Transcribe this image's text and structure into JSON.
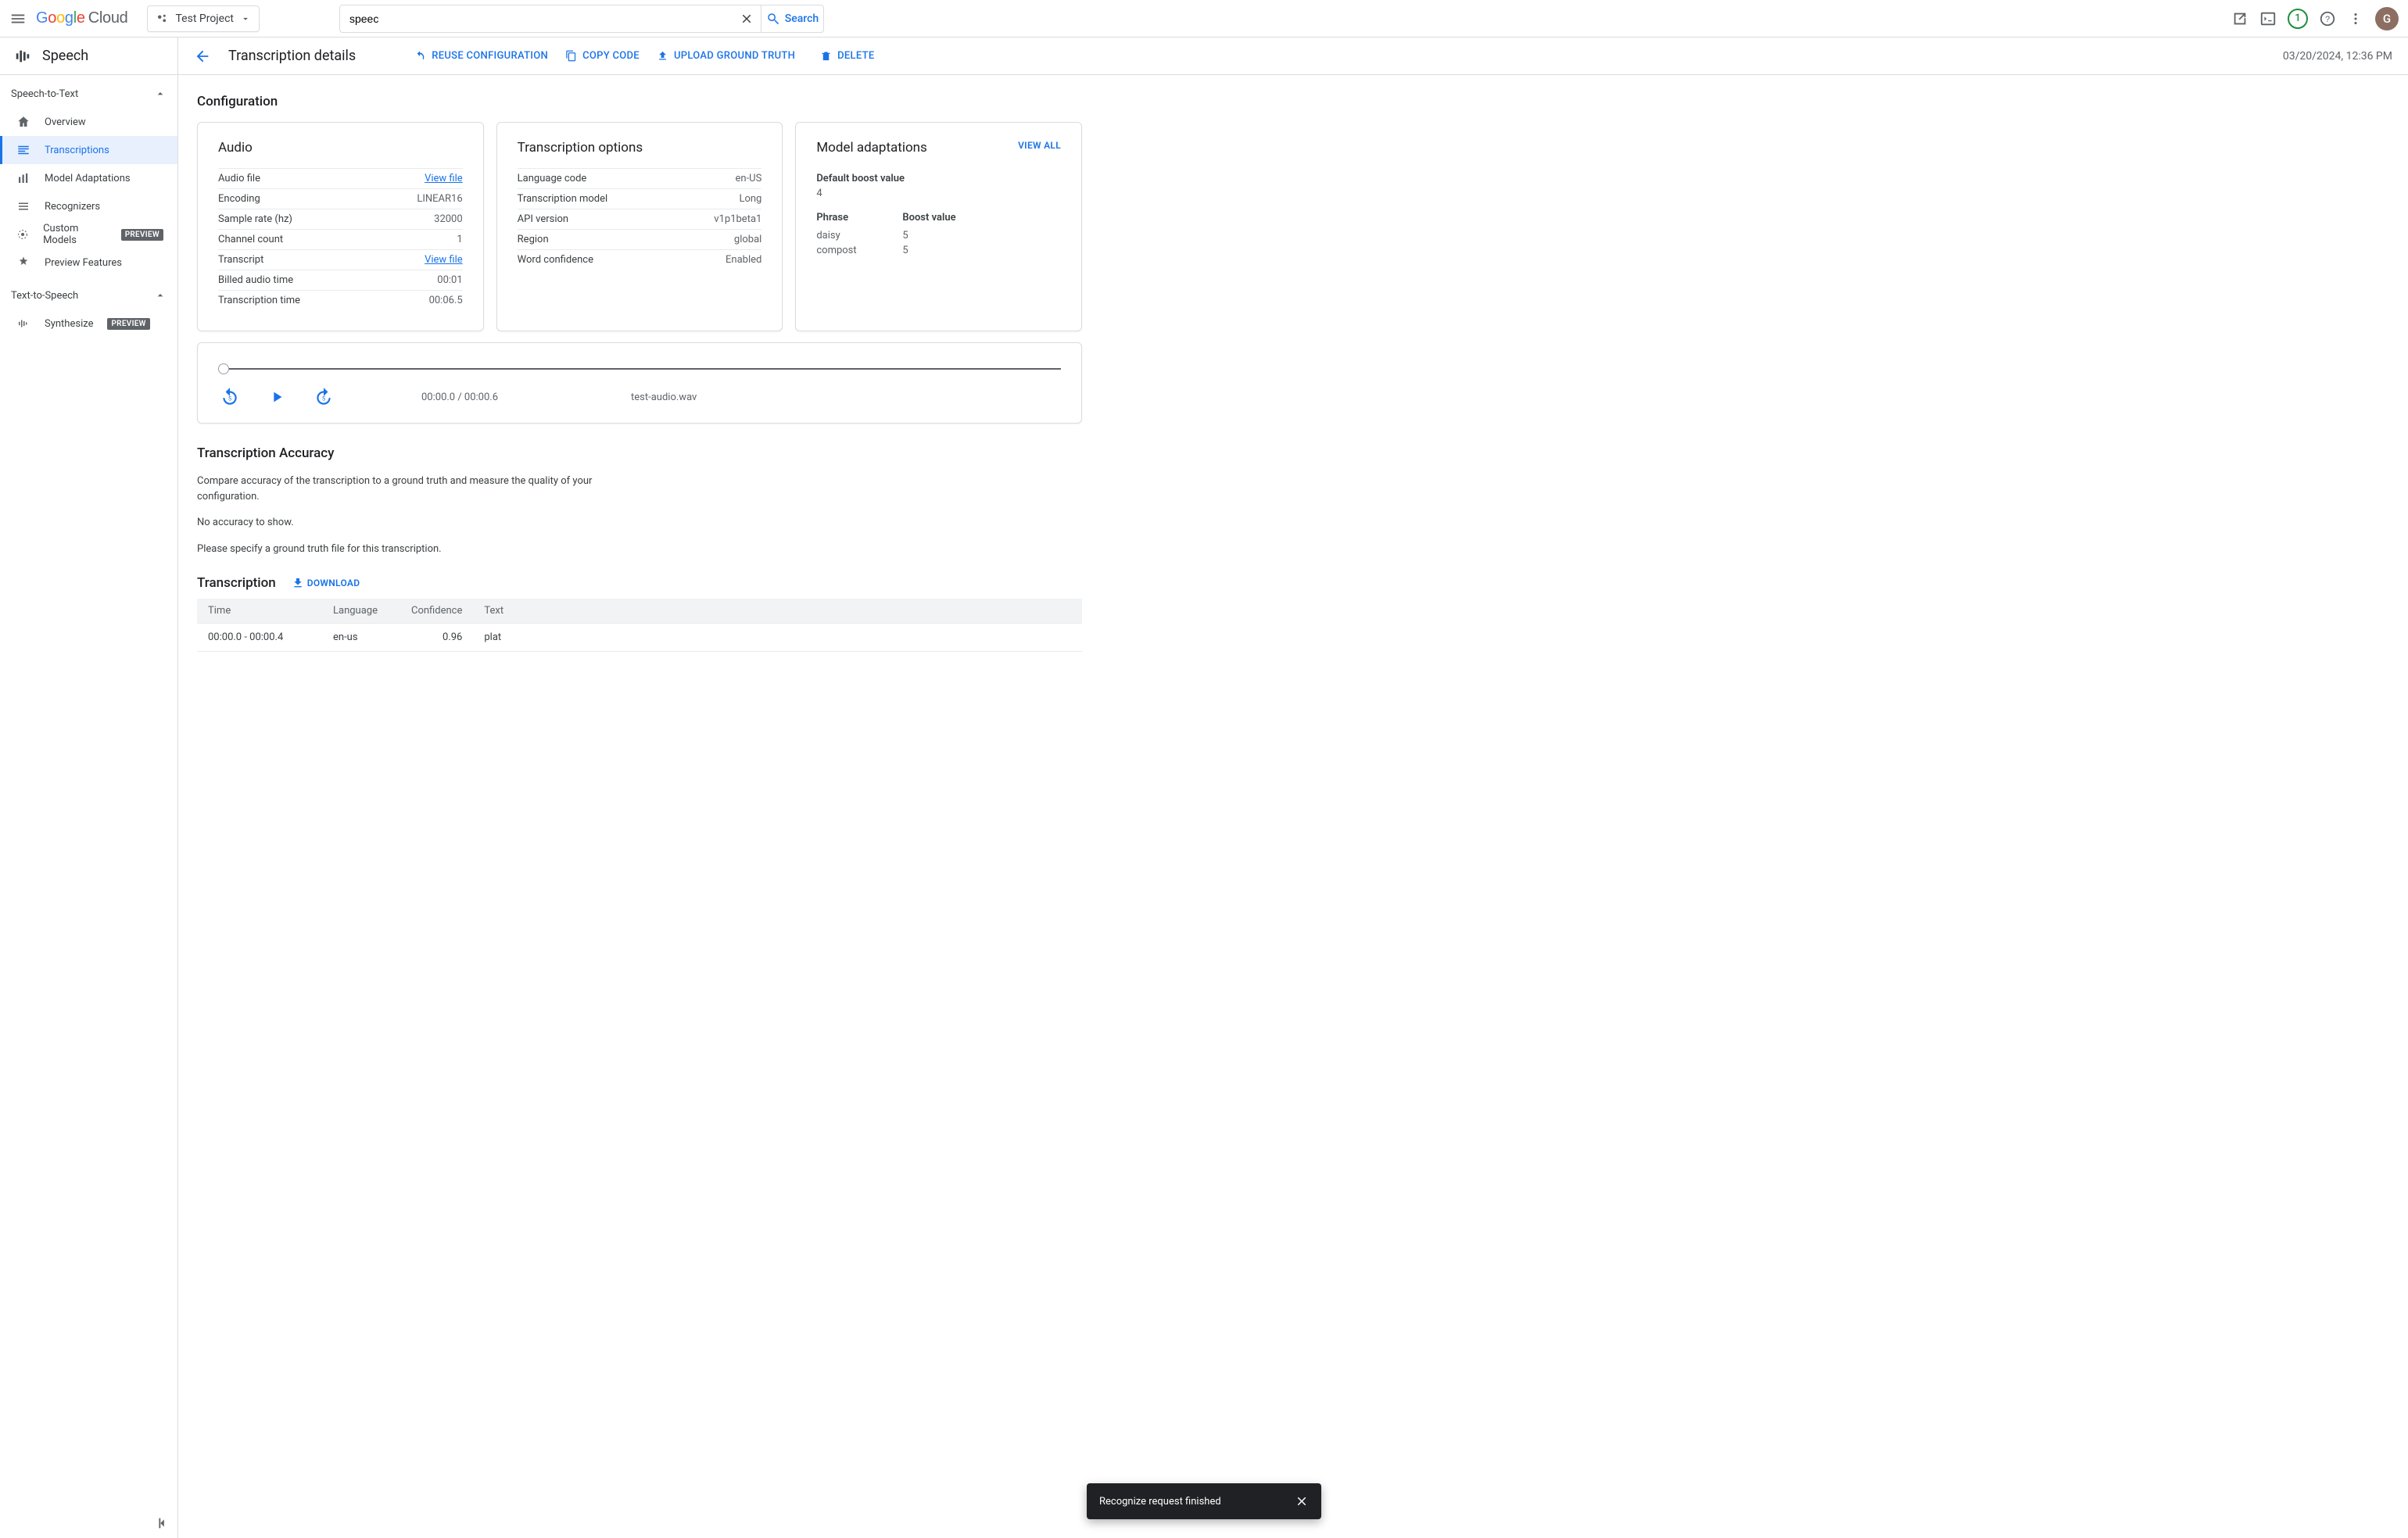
{
  "header": {
    "logo_cloud": "Cloud",
    "project": "Test Project",
    "search_value": "speec",
    "search_button": "Search",
    "free_trial_badge": "1",
    "avatar_letter": "G"
  },
  "sidebar": {
    "product": "Speech",
    "sections": [
      {
        "label": "Speech-to-Text",
        "items": [
          {
            "label": "Overview",
            "active": false,
            "preview": false
          },
          {
            "label": "Transcriptions",
            "active": true,
            "preview": false
          },
          {
            "label": "Model Adaptations",
            "active": false,
            "preview": false
          },
          {
            "label": "Recognizers",
            "active": false,
            "preview": false
          },
          {
            "label": "Custom Models",
            "active": false,
            "preview": true
          },
          {
            "label": "Preview Features",
            "active": false,
            "preview": false
          }
        ]
      },
      {
        "label": "Text-to-Speech",
        "items": [
          {
            "label": "Synthesize",
            "active": false,
            "preview": true
          }
        ]
      }
    ],
    "preview_badge": "PREVIEW"
  },
  "page": {
    "title": "Transcription details",
    "actions": {
      "reuse": "REUSE CONFIGURATION",
      "copy": "COPY CODE",
      "upload": "UPLOAD GROUND TRUTH",
      "delete": "DELETE"
    },
    "timestamp": "03/20/2024, 12:36 PM"
  },
  "config": {
    "heading": "Configuration",
    "audio": {
      "title": "Audio",
      "rows": [
        {
          "k": "Audio file",
          "v": "View file",
          "link": true
        },
        {
          "k": "Encoding",
          "v": "LINEAR16"
        },
        {
          "k": "Sample rate (hz)",
          "v": "32000"
        },
        {
          "k": "Channel count",
          "v": "1"
        },
        {
          "k": "Transcript",
          "v": "View file",
          "link": true
        },
        {
          "k": "Billed audio time",
          "v": "00:01"
        },
        {
          "k": "Transcription time",
          "v": "00:06.5"
        }
      ]
    },
    "options": {
      "title": "Transcription options",
      "rows": [
        {
          "k": "Language code",
          "v": "en-US"
        },
        {
          "k": "Transcription model",
          "v": "Long"
        },
        {
          "k": "API version",
          "v": "v1p1beta1"
        },
        {
          "k": "Region",
          "v": "global"
        },
        {
          "k": "Word confidence",
          "v": "Enabled"
        }
      ]
    },
    "adapt": {
      "title": "Model adaptations",
      "view_all": "VIEW ALL",
      "default_label": "Default boost value",
      "default_value": "4",
      "col_phrase": "Phrase",
      "col_boost": "Boost value",
      "rows": [
        {
          "phrase": "daisy",
          "boost": "5"
        },
        {
          "phrase": "compost",
          "boost": "5"
        }
      ]
    }
  },
  "player": {
    "time": "00:00.0 / 00:00.6",
    "filename": "test-audio.wav"
  },
  "accuracy": {
    "heading": "Transcription Accuracy",
    "p1": "Compare accuracy of the transcription to a ground truth and measure the quality of your configuration.",
    "p2": "No accuracy to show.",
    "p3": "Please specify a ground truth file for this transcription."
  },
  "transcription": {
    "heading": "Transcription",
    "download": "DOWNLOAD",
    "cols": {
      "time": "Time",
      "lang": "Language",
      "conf": "Confidence",
      "text": "Text"
    },
    "rows": [
      {
        "time": "00:00.0 - 00:00.4",
        "lang": "en-us",
        "conf": "0.96",
        "text": "plat"
      }
    ]
  },
  "toast": {
    "message": "Recognize request finished"
  }
}
